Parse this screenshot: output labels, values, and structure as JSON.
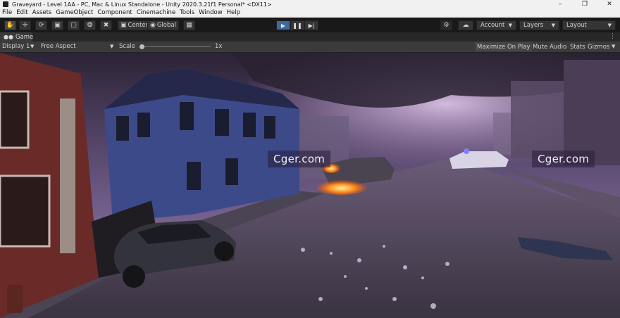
{
  "window": {
    "title": "Graveyard - Level 1AA - PC, Mac & Linux Standalone - Unity 2020.3.21f1 Personal* <DX11>",
    "controls": [
      "–",
      "❐",
      "✕"
    ]
  },
  "menu": [
    "File",
    "Edit",
    "Assets",
    "GameObject",
    "Component",
    "Cinemachine",
    "Tools",
    "Window",
    "Help"
  ],
  "toolbar": {
    "tools": [
      "hand-tool",
      "move-tool",
      "rotate-tool",
      "scale-tool",
      "rect-tool",
      "transform-tool",
      "custom-tool"
    ],
    "pivot_label": "Center",
    "space_label": "Global",
    "account_label": "Account",
    "layers_label": "Layers",
    "layout_label": "Layout"
  },
  "game_tab": {
    "label": "Game"
  },
  "game_controls": {
    "display": "Display 1",
    "aspect": "Free Aspect",
    "scale_label": "Scale",
    "scale_value": "1x",
    "scale_fraction": 0.0,
    "maximize_label": "Maximize On Play",
    "mute_label": "Mute Audio",
    "stats_label": "Stats",
    "gizmos_label": "Gizmos"
  },
  "watermarks": [
    "Cger.com",
    "Cger.com"
  ],
  "colors": {
    "play_active": "#3d6a9a",
    "sky_top": "#2c2336",
    "sky_glow": "#b48ec4",
    "house_blue": "#3d4a8a",
    "house_red": "#6a2a28",
    "fire": "#ff8a1a"
  }
}
